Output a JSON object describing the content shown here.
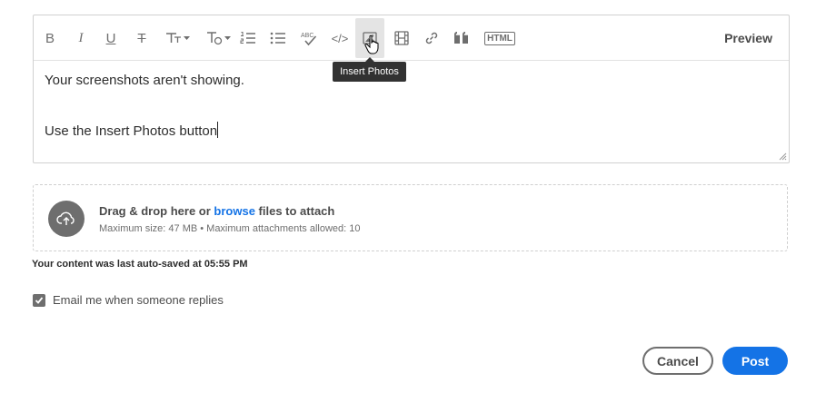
{
  "toolbar": {
    "buttons": [
      {
        "name": "bold",
        "icon": "bold-icon",
        "glyph": "B"
      },
      {
        "name": "italic",
        "icon": "italic-icon",
        "glyph": "I"
      },
      {
        "name": "underline",
        "icon": "underline-icon",
        "glyph": "U"
      },
      {
        "name": "strikethrough",
        "icon": "strikethrough-icon",
        "glyph": "T"
      },
      {
        "name": "font-size",
        "icon": "font-size-icon",
        "glyph": "T"
      },
      {
        "name": "text-style",
        "icon": "text-style-icon",
        "glyph": "T"
      },
      {
        "name": "numbered-list",
        "icon": "numbered-list-icon"
      },
      {
        "name": "bulleted-list",
        "icon": "bulleted-list-icon"
      },
      {
        "name": "spellcheck",
        "icon": "spellcheck-icon",
        "glyph": "ABC"
      },
      {
        "name": "code",
        "icon": "code-icon",
        "glyph": "</>"
      },
      {
        "name": "insert-photos",
        "icon": "image-icon"
      },
      {
        "name": "insert-video",
        "icon": "film-icon"
      },
      {
        "name": "insert-link",
        "icon": "link-icon"
      },
      {
        "name": "quote",
        "icon": "quote-icon"
      },
      {
        "name": "html",
        "icon": "html-icon",
        "glyph": "HTML"
      }
    ],
    "preview_label": "Preview",
    "tooltip": "Insert Photos"
  },
  "editor": {
    "line1": "Your screenshots aren't showing.",
    "line2": "Use the Insert Photos button"
  },
  "dropzone": {
    "prefix": "Drag & drop here or ",
    "browse_label": "browse",
    "suffix": " files to attach",
    "limits": "Maximum size: 47 MB • Maximum attachments allowed: 10"
  },
  "autosave_text": "Your content was last auto-saved at 05:55 PM",
  "email_option": {
    "label": "Email me when someone replies",
    "checked": true
  },
  "actions": {
    "cancel_label": "Cancel",
    "post_label": "Post"
  },
  "colors": {
    "accent": "#1473e6",
    "icon_gray": "#6e6e6e",
    "tooltip_bg": "#323232"
  }
}
